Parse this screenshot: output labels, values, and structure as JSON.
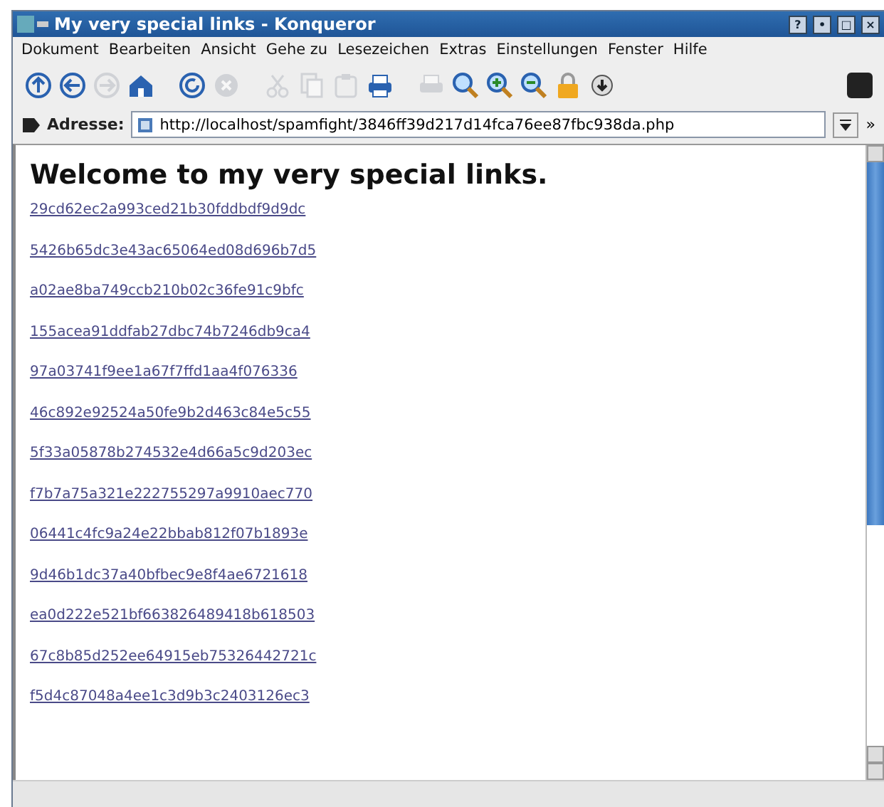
{
  "window": {
    "title": "My very special links - Konqueror",
    "controls": [
      "?",
      "•",
      "□",
      "×"
    ]
  },
  "menu": [
    "Dokument",
    "Bearbeiten",
    "Ansicht",
    "Gehe zu",
    "Lesezeichen",
    "Extras",
    "Einstellungen",
    "Fenster",
    "Hilfe"
  ],
  "toolbar": [
    {
      "kind": "up",
      "disabled": false
    },
    {
      "kind": "back",
      "disabled": false
    },
    {
      "kind": "forward",
      "disabled": true
    },
    {
      "kind": "home",
      "disabled": false
    },
    {
      "kind": "reload",
      "disabled": false
    },
    {
      "kind": "stop",
      "disabled": true
    },
    {
      "kind": "cut",
      "disabled": true
    },
    {
      "kind": "copy",
      "disabled": true
    },
    {
      "kind": "paste",
      "disabled": true
    },
    {
      "kind": "print",
      "disabled": false
    },
    {
      "kind": "printframe",
      "disabled": true
    },
    {
      "kind": "find",
      "disabled": false
    },
    {
      "kind": "zoomin",
      "disabled": false
    },
    {
      "kind": "zoomout",
      "disabled": false
    },
    {
      "kind": "lock",
      "disabled": false
    },
    {
      "kind": "security",
      "disabled": false
    }
  ],
  "address": {
    "label": "Adresse:",
    "value": "http://localhost/spamfight/3846ff39d217d14fca76ee87fbc938da.php",
    "more": "»"
  },
  "page": {
    "heading": "Welcome to my very special links.",
    "links": [
      "29cd62ec2a993ced21b30fddbdf9d9dc",
      "5426b65dc3e43ac65064ed08d696b7d5",
      "a02ae8ba749ccb210b02c36fe91c9bfc",
      "155acea91ddfab27dbc74b7246db9ca4",
      "97a03741f9ee1a67f7ffd1aa4f076336",
      "46c892e92524a50fe9b2d463c84e5c55",
      "5f33a05878b274532e4d66a5c9d203ec",
      "f7b7a75a321e222755297a9910aec770",
      "06441c4fc9a24e22bbab812f07b1893e",
      "9d46b1dc37a40bfbec9e8f4ae6721618",
      "ea0d222e521bf663826489418b618503",
      "67c8b85d252ee64915eb75326442721c",
      "f5d4c87048a4ee1c3d9b3c2403126ec3"
    ]
  }
}
